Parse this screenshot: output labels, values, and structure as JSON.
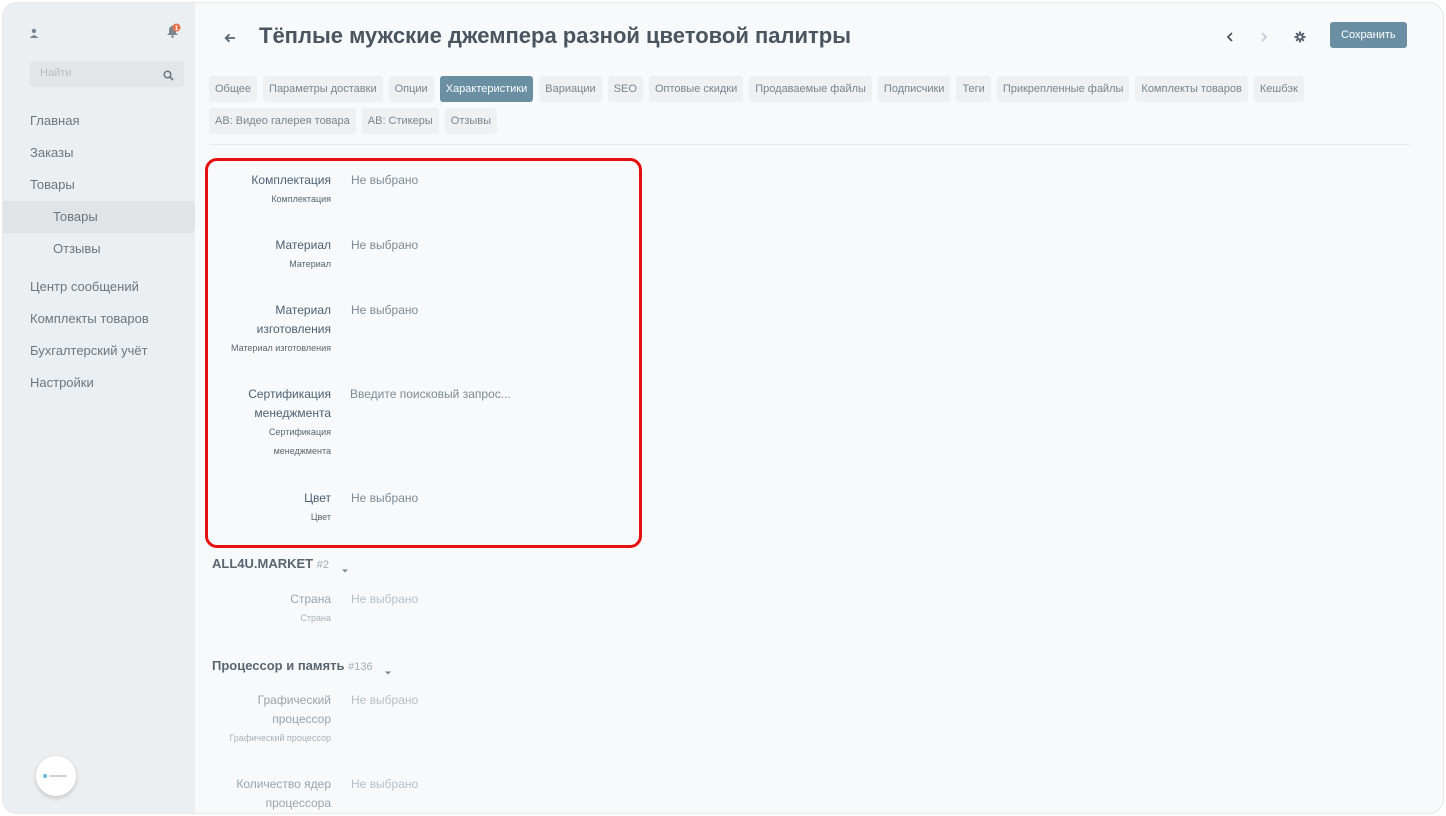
{
  "sidebar": {
    "search_placeholder": "Найти",
    "items": [
      {
        "label": "Главная"
      },
      {
        "label": "Заказы"
      },
      {
        "label": "Товары"
      },
      {
        "label": "Товары"
      },
      {
        "label": "Отзывы"
      },
      {
        "label": "Центр сообщений"
      },
      {
        "label": "Комплекты товаров"
      },
      {
        "label": "Бухгалтерский учёт"
      },
      {
        "label": "Настройки"
      }
    ],
    "notification_count": "1"
  },
  "header": {
    "title": "Тёплые мужские джемпера разной цветовой палитры",
    "save_label": "Сохранить"
  },
  "tabs": [
    "Общее",
    "Параметры доставки",
    "Опции",
    "Характеристики",
    "Вариации",
    "SEO",
    "Оптовые скидки",
    "Продаваемые файлы",
    "Подписчики",
    "Теги",
    "Прикрепленные файлы",
    "Комплекты товаров",
    "Кешбэк",
    "AB: Видео галерея товара",
    "AB: Стикеры",
    "Отзывы"
  ],
  "active_tab": "Характеристики",
  "features": [
    {
      "label_1": "Комплектация",
      "sub_1": "Комплектация",
      "value": "Не выбрано"
    },
    {
      "label_1": "Материал",
      "sub_1": "Материал",
      "value": "Не выбрано"
    },
    {
      "label_1": "Материал",
      "label_2": "изготовления",
      "sub_1": "Материал изготовления",
      "value": "Не выбрано"
    },
    {
      "label_1": "Сертификация",
      "label_2": "менеджмента",
      "sub_1": "Сертификация",
      "sub_2": "менеджмента",
      "placeholder": "Введите поисковый запрос..."
    },
    {
      "label_1": "Цвет",
      "sub_1": "Цвет",
      "value": "Не выбрано"
    }
  ],
  "groups": [
    {
      "name": "ALL4U.MARKET",
      "id": "#2",
      "fields": [
        {
          "label_1": "Страна",
          "sub_1": "Страна",
          "value": "Не выбрано"
        }
      ]
    },
    {
      "name": "Процессор и память",
      "id": "#136",
      "fields": [
        {
          "label_1": "Графический",
          "label_2": "процессор",
          "sub_1": "Графический процессор",
          "value": "Не выбрано"
        },
        {
          "label_1": "Количество ядер",
          "label_2": "процессора",
          "value": "Не выбрано"
        }
      ]
    }
  ],
  "colors": {
    "accent": "#6a8fa3",
    "highlight": "#e50f0f",
    "notification": "#e8734a"
  }
}
